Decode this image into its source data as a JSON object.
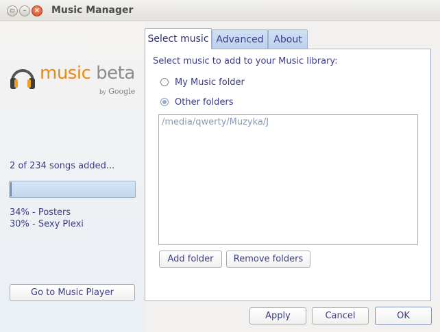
{
  "window": {
    "title": "Music Manager"
  },
  "titlebar": {
    "minimize_glyph": "–",
    "restore_glyph": "▫",
    "close_glyph": "×"
  },
  "logo": {
    "word_music": "music",
    "word_beta": " beta",
    "by": "by",
    "company": "Google"
  },
  "status": {
    "songs_added": "2 of 234 songs added...",
    "progress_fraction": 0.01,
    "uploads": [
      "34% - Posters",
      "30% - Sexy Plexi"
    ]
  },
  "left_panel": {
    "go_to_player_label": "Go to Music Player"
  },
  "tabs": [
    {
      "label": "Select music",
      "active": true
    },
    {
      "label": "Advanced",
      "active": false
    },
    {
      "label": "About",
      "active": false
    }
  ],
  "select_music": {
    "instruction": "Select music to add to your Music library:",
    "options": [
      {
        "label": "My Music folder",
        "checked": false
      },
      {
        "label": "Other folders",
        "checked": true
      }
    ],
    "folders": [
      "/media/qwerty/Muzyka/J"
    ],
    "add_folder_label": "Add folder",
    "remove_folders_label": "Remove folders"
  },
  "dialog_buttons": {
    "apply_label": "Apply",
    "cancel_label": "Cancel",
    "ok_label": "OK"
  },
  "colors": {
    "accent_text": "#3b3b88",
    "logo_orange": "#e88a1a",
    "tab_blue": "#bcd1ec",
    "close_red": "#d84a1f"
  },
  "icons": {
    "logo_icon": "headphones-icon"
  }
}
